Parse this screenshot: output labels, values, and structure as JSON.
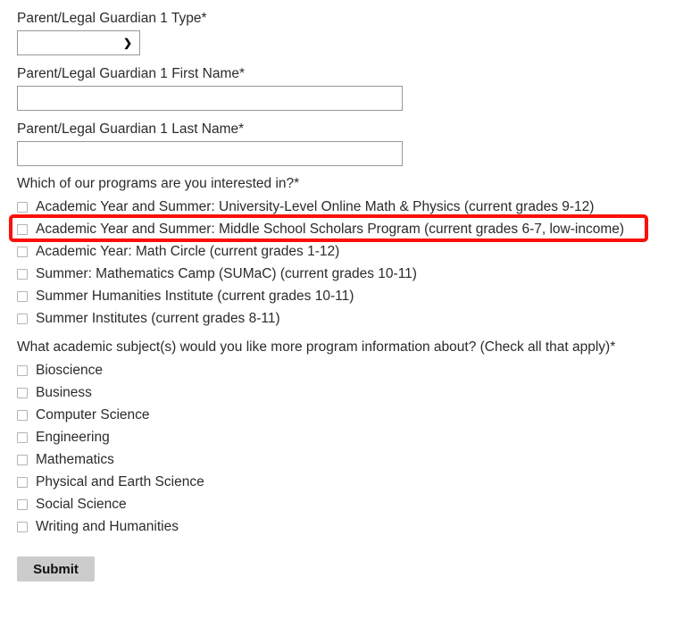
{
  "form": {
    "fields": [
      {
        "label": "Parent/Legal Guardian 1 Type*",
        "type": "select",
        "value": "",
        "placeholder": "",
        "arrow_icon": "chevron-down-icon"
      },
      {
        "label": "Parent/Legal Guardian 1 First Name*",
        "type": "text",
        "value": "",
        "placeholder": ""
      },
      {
        "label": "Parent/Legal Guardian 1 Last Name*",
        "type": "text",
        "value": "",
        "placeholder": ""
      }
    ],
    "programs_question": {
      "text": "Which of our programs are you interested in?*",
      "options": [
        {
          "label": "Academic Year and Summer: University-Level Online Math & Physics (current grades 9-12)",
          "checked": false
        },
        {
          "label": "Academic Year and Summer: Middle School Scholars Program (current grades 6-7, low-income)",
          "checked": false
        },
        {
          "label": "Academic Year: Math Circle (current grades 1-12)",
          "checked": false
        },
        {
          "label": "Summer: Mathematics Camp (SUMaC) (current grades 10-11)",
          "checked": false
        },
        {
          "label": "Summer Humanities Institute (current grades 10-11)",
          "checked": false
        },
        {
          "label": "Summer Institutes (current grades 8-11)",
          "checked": false
        }
      ]
    },
    "subjects_question": {
      "text": "What academic subject(s) would you like more program information about? (Check all that apply)*",
      "options": [
        {
          "label": "Bioscience",
          "checked": false
        },
        {
          "label": "Business",
          "checked": false
        },
        {
          "label": "Computer Science",
          "checked": false
        },
        {
          "label": "Engineering",
          "checked": false
        },
        {
          "label": "Mathematics",
          "checked": false
        },
        {
          "label": "Physical and Earth Science",
          "checked": false
        },
        {
          "label": "Social Science",
          "checked": false
        },
        {
          "label": "Writing and Humanities",
          "checked": false
        }
      ]
    },
    "submit_label": "Submit"
  },
  "annotation": {
    "highlight_color": "#fb0f08",
    "target_label": "Academic Year and Summer: University-Level Online Math & Physics (current grades 9-12)"
  }
}
